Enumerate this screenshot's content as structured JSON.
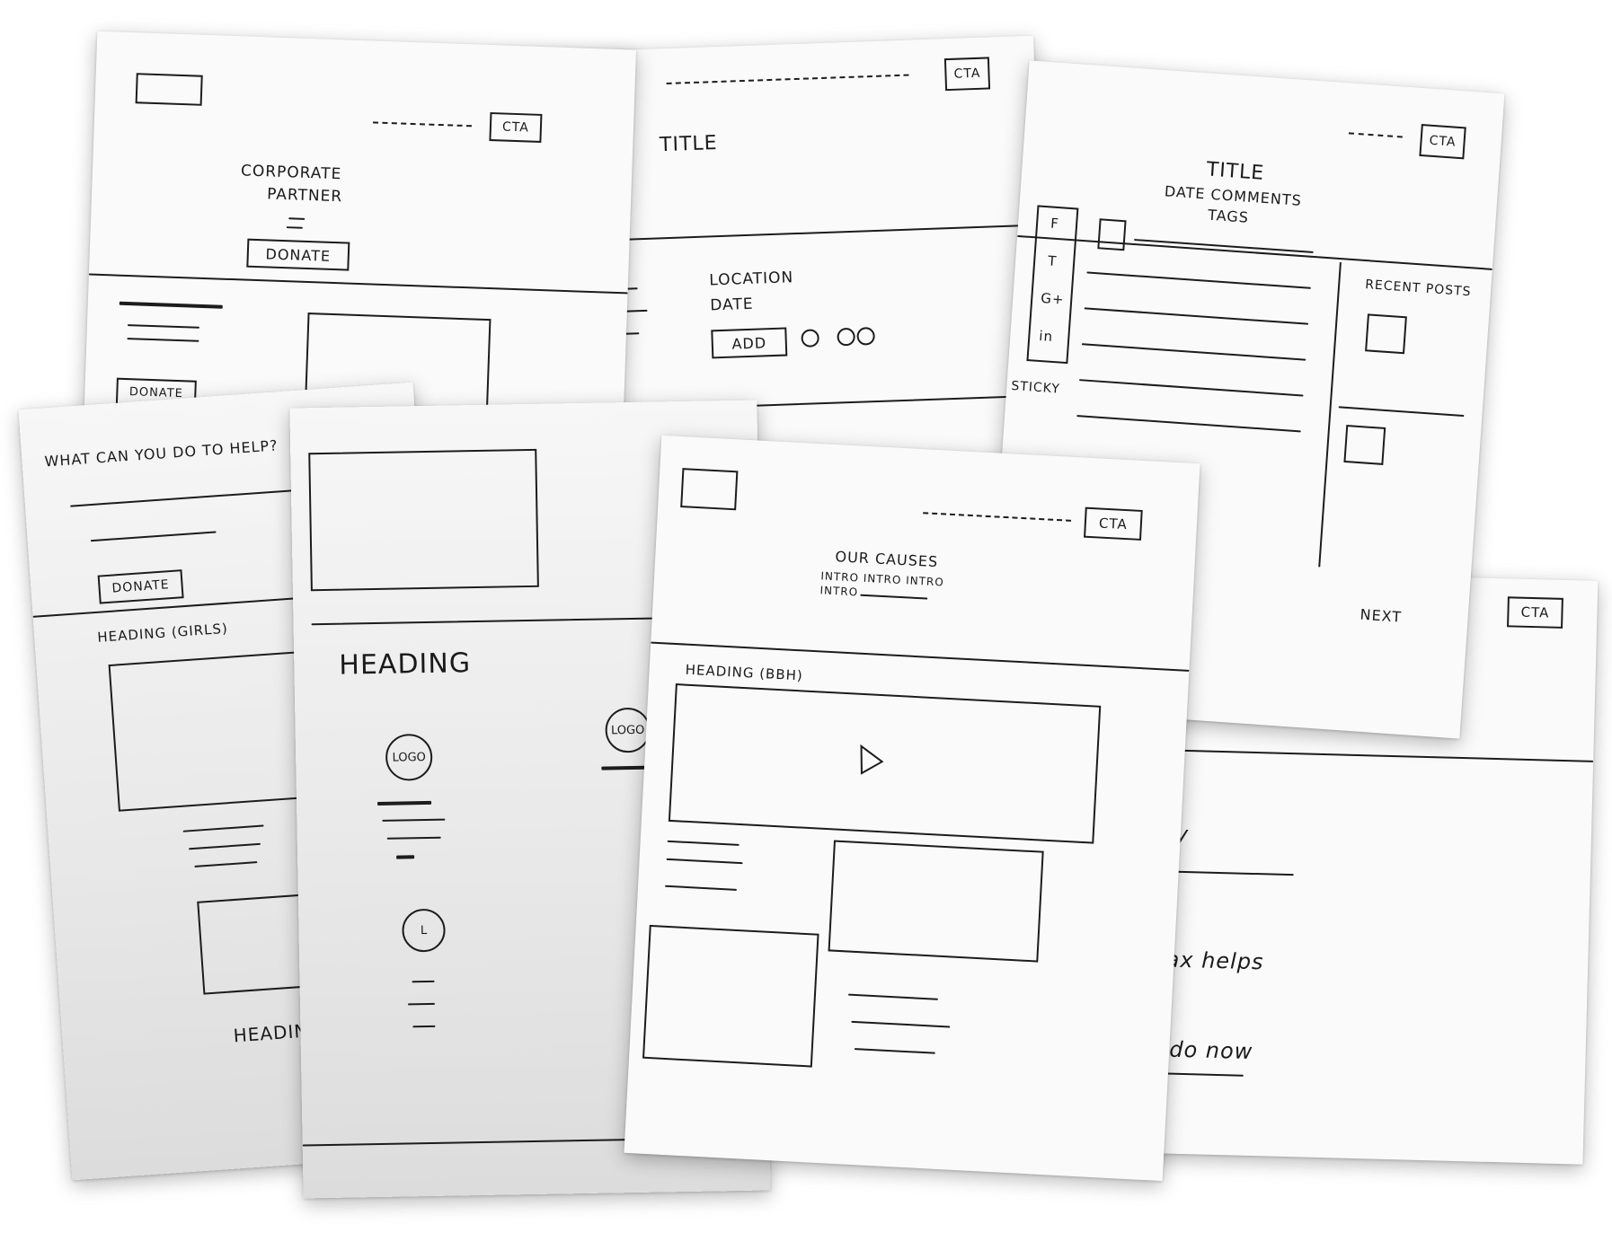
{
  "sketches": {
    "corporate": {
      "cta": "CTA",
      "title_line1": "CORPORATE",
      "title_line2": "PARTNER",
      "donate": "DONATE",
      "donate2": "DONATE"
    },
    "event": {
      "cta": "CTA",
      "title": "TITLE",
      "location": "LOCATION",
      "date": "DATE",
      "add": "ADD"
    },
    "blog": {
      "cta": "CTA",
      "title": "TITLE",
      "meta": "DATE COMMENTS",
      "tags": "TAGS",
      "share": [
        "F",
        "T",
        "G+",
        "in"
      ],
      "sticky": "STICKY",
      "recent_posts": "RECENT POSTS"
    },
    "help": {
      "question": "WHAT CAN YOU DO TO HELP?",
      "donate": "DONATE",
      "heading": "HEADING (GIRLS)",
      "heading_bottom": "HEADING"
    },
    "partners": {
      "heading": "HEADING",
      "logo1": "LOGO",
      "logo2": "LOGO",
      "logo3": "L"
    },
    "causes": {
      "cta": "CTA",
      "title": "OUR CAUSES",
      "intro": "INTRO INTRO INTRO",
      "intro2": "INTRO",
      "heading": "HEADING (BBH)",
      "play_icon": "play-icon"
    },
    "back_right": {
      "cta": "CTA",
      "next": "NEXT",
      "text1": "ify",
      "text2": "tax helps",
      "text3": "I do now"
    }
  }
}
